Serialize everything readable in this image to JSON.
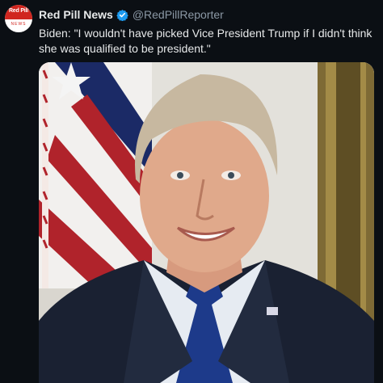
{
  "account": {
    "display_name": "Red Pill News",
    "handle": "@RedPillReporter",
    "avatar_text": "Red Pill",
    "avatar_subtext": "NEWS",
    "verified_icon": "verified-badge-icon"
  },
  "tweet": {
    "text": "Biden: \"I wouldn't have picked Vice President Trump if I didn't think she was qualified to be president.\""
  },
  "colors": {
    "background": "#0b0f14",
    "name": "#e7e9ea",
    "handle": "#8b98a5",
    "verified": "#1d9bf0",
    "brand_red": "#d0261f"
  }
}
